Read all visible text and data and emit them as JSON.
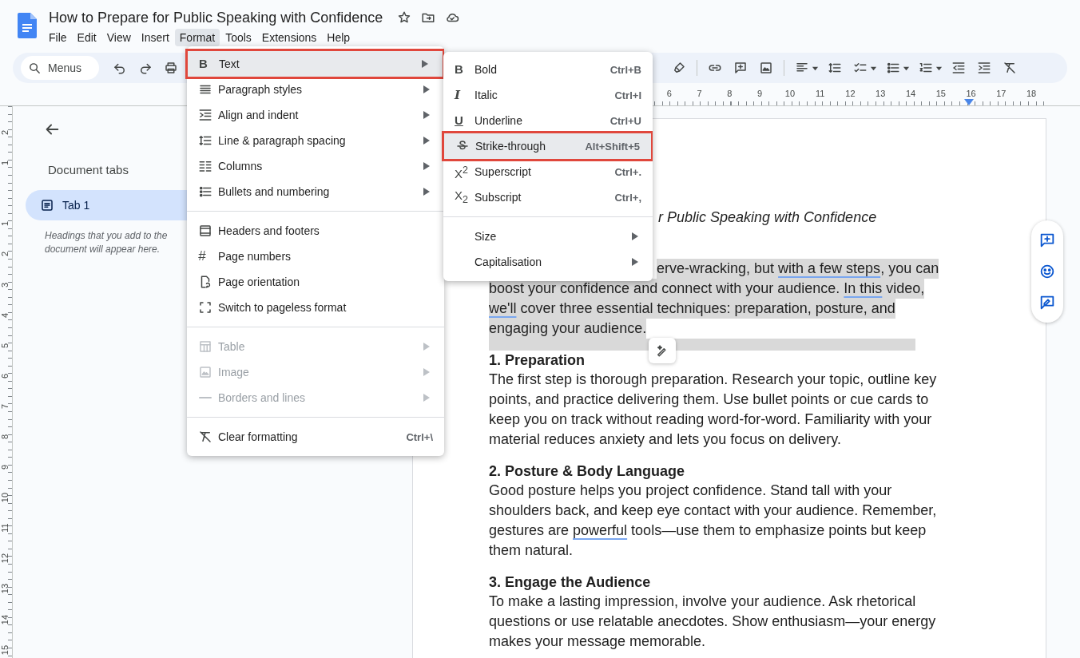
{
  "app": {
    "title": "How to Prepare for Public Speaking with Confidence"
  },
  "menubar": [
    {
      "label": "File",
      "selected": false
    },
    {
      "label": "Edit",
      "selected": false
    },
    {
      "label": "View",
      "selected": false
    },
    {
      "label": "Insert",
      "selected": false
    },
    {
      "label": "Format",
      "selected": true
    },
    {
      "label": "Tools",
      "selected": false
    },
    {
      "label": "Extensions",
      "selected": false
    },
    {
      "label": "Help",
      "selected": false
    }
  ],
  "toolbar": {
    "search": {
      "placeholder": "Menus"
    }
  },
  "ruler": {
    "horizontal": [
      "6",
      "7",
      "8",
      "9",
      "10",
      "11",
      "12",
      "13",
      "14",
      "15",
      "16",
      "17",
      "18"
    ],
    "vertical_above": [
      "2",
      "1"
    ],
    "vertical_below": [
      "1",
      "2",
      "3",
      "4",
      "5",
      "6",
      "7",
      "8",
      "9",
      "10",
      "11",
      "12",
      "13",
      "14",
      "15"
    ]
  },
  "sidebar": {
    "heading": "Document tabs",
    "tabs": [
      {
        "label": "Tab 1",
        "selected": true
      }
    ],
    "hint": "Headings that you add to the document will appear here."
  },
  "document": {
    "title_fragment": "r Public Speaking with Confidence",
    "blocks": [
      {
        "kind": "paragraph",
        "selected": true,
        "lines": [
          [
            {
              "text": "erve-wracking, but ",
              "flagged": false
            },
            {
              "text": "with a few steps",
              "flagged": true
            },
            {
              "text": ", you can",
              "flagged": false
            }
          ],
          [
            {
              "text": "boost your confidence and connect with your audience. ",
              "flagged": false
            },
            {
              "text": "In this",
              "flagged": true
            },
            {
              "text": " video,",
              "flagged": false
            }
          ],
          [
            {
              "text": "we'll",
              "flagged": true
            },
            {
              "text": " cover three essential techniques: preparation, posture, and",
              "flagged": false
            }
          ],
          [
            {
              "text": "engaging your audience.",
              "flagged": false
            }
          ]
        ]
      },
      {
        "kind": "blank",
        "selected": true
      },
      {
        "kind": "heading",
        "text": "1. Preparation"
      },
      {
        "kind": "paragraph",
        "selected": false,
        "lines": [
          [
            {
              "text": "The first step is thorough preparation. Research your topic, outline key",
              "flagged": false
            }
          ],
          [
            {
              "text": "points, and practice delivering them. Use bullet points or cue cards to",
              "flagged": false
            }
          ],
          [
            {
              "text": "keep you on track without reading word-for-word. Familiarity with your",
              "flagged": false
            }
          ],
          [
            {
              "text": "material reduces anxiety and lets you focus on delivery.",
              "flagged": false
            }
          ]
        ]
      },
      {
        "kind": "heading",
        "text": "2. Posture & Body Language"
      },
      {
        "kind": "paragraph",
        "selected": false,
        "lines": [
          [
            {
              "text": "Good posture helps you project confidence. Stand tall with your",
              "flagged": false
            }
          ],
          [
            {
              "text": "shoulders back, and keep eye contact with your audience. Remember,",
              "flagged": false
            }
          ],
          [
            {
              "text": "gestures are ",
              "flagged": false
            },
            {
              "text": "powerful",
              "flagged": true
            },
            {
              "text": " tools—use them to emphasize points but keep",
              "flagged": false
            }
          ],
          [
            {
              "text": "them natural.",
              "flagged": false
            }
          ]
        ]
      },
      {
        "kind": "heading",
        "text": "3. Engage the Audience"
      },
      {
        "kind": "paragraph",
        "selected": false,
        "lines": [
          [
            {
              "text": "To make a lasting impression, involve your audience. Ask rhetorical",
              "flagged": false
            }
          ],
          [
            {
              "text": "questions or use relatable anecdotes. Show enthusiasm—your energy",
              "flagged": false
            }
          ],
          [
            {
              "text": "makes your message memorable.",
              "flagged": false
            }
          ]
        ]
      }
    ]
  },
  "format_menu": {
    "groups": [
      {
        "items": [
          {
            "label": "Text",
            "glyph": "B",
            "has_submenu": true,
            "disabled": false,
            "selected": true,
            "callout": true
          },
          {
            "label": "Paragraph styles",
            "has_submenu": true,
            "disabled": false,
            "selected": false,
            "callout": false
          },
          {
            "label": "Align and indent",
            "has_submenu": true,
            "disabled": false,
            "selected": false,
            "callout": false
          },
          {
            "label": "Line & paragraph spacing",
            "has_submenu": true,
            "disabled": false,
            "selected": false,
            "callout": false
          },
          {
            "label": "Columns",
            "has_submenu": true,
            "disabled": false,
            "selected": false,
            "callout": false
          },
          {
            "label": "Bullets and numbering",
            "has_submenu": true,
            "disabled": false,
            "selected": false,
            "callout": false
          }
        ]
      },
      {
        "items": [
          {
            "label": "Headers and footers",
            "has_submenu": false,
            "disabled": false,
            "selected": false,
            "callout": false
          },
          {
            "label": "Page numbers",
            "glyph": "#",
            "has_submenu": false,
            "disabled": false,
            "selected": false,
            "callout": false
          },
          {
            "label": "Page orientation",
            "has_submenu": false,
            "disabled": false,
            "selected": false,
            "callout": false
          },
          {
            "label": "Switch to pageless format",
            "has_submenu": false,
            "disabled": false,
            "selected": false,
            "callout": false
          }
        ]
      },
      {
        "items": [
          {
            "label": "Table",
            "has_submenu": true,
            "disabled": true,
            "selected": false,
            "callout": false
          },
          {
            "label": "Image",
            "has_submenu": true,
            "disabled": true,
            "selected": false,
            "callout": false
          },
          {
            "label": "Borders and lines",
            "has_submenu": true,
            "disabled": true,
            "selected": false,
            "callout": false
          }
        ]
      },
      {
        "items": [
          {
            "label": "Clear formatting",
            "shortcut": "Ctrl+\\",
            "has_submenu": false,
            "disabled": false,
            "selected": false,
            "callout": false
          }
        ]
      }
    ]
  },
  "text_submenu": {
    "groups": [
      {
        "items": [
          {
            "label": "Bold",
            "glyph": "B",
            "shortcut": "Ctrl+B",
            "has_submenu": false,
            "disabled": false,
            "selected": false,
            "callout": false
          },
          {
            "label": "Italic",
            "glyph": "I",
            "shortcut": "Ctrl+I",
            "has_submenu": false,
            "disabled": false,
            "selected": false,
            "callout": false
          },
          {
            "label": "Underline",
            "glyph": "U",
            "shortcut": "Ctrl+U",
            "has_submenu": false,
            "disabled": false,
            "selected": false,
            "callout": false
          },
          {
            "label": "Strike-through",
            "shortcut": "Alt+Shift+5",
            "has_submenu": false,
            "disabled": false,
            "selected": true,
            "callout": true
          },
          {
            "label": "Superscript",
            "glyph": "X$^{2}$",
            "shortcut": "Ctrl+.",
            "has_submenu": false,
            "disabled": false,
            "selected": false,
            "callout": false
          },
          {
            "label": "Subscript",
            "glyph": "X$_{2}$",
            "shortcut": "Ctrl+,",
            "has_submenu": false,
            "disabled": false,
            "selected": false,
            "callout": false
          }
        ]
      },
      {
        "items": [
          {
            "label": "Size",
            "has_submenu": true,
            "disabled": false,
            "selected": false,
            "callout": false
          },
          {
            "label": "Capitalisation",
            "has_submenu": true,
            "disabled": false,
            "selected": false,
            "callout": false
          }
        ]
      }
    ]
  }
}
